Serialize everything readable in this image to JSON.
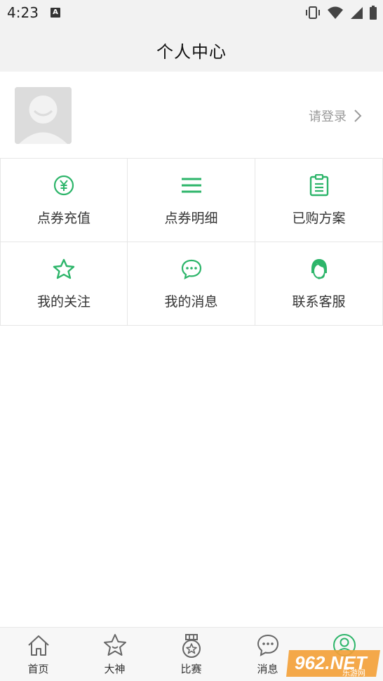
{
  "status_bar": {
    "time": "4:23",
    "notification_icon": "A"
  },
  "header": {
    "title": "个人中心"
  },
  "profile": {
    "login_label": "请登录"
  },
  "grid": [
    {
      "label": "点券充值",
      "icon": "yen-circle-icon"
    },
    {
      "label": "点券明细",
      "icon": "list-lines-icon"
    },
    {
      "label": "已购方案",
      "icon": "clipboard-icon"
    },
    {
      "label": "我的关注",
      "icon": "star-icon"
    },
    {
      "label": "我的消息",
      "icon": "chat-bubble-icon"
    },
    {
      "label": "联系客服",
      "icon": "customer-service-icon"
    }
  ],
  "bottom_nav": [
    {
      "label": "首页",
      "icon": "home-icon"
    },
    {
      "label": "大神",
      "icon": "star-icon"
    },
    {
      "label": "比赛",
      "icon": "medal-icon"
    },
    {
      "label": "消息",
      "icon": "chat-bubble-icon"
    },
    {
      "label": "",
      "icon": "user-icon",
      "active": true
    }
  ],
  "watermark": {
    "text": "962.NET",
    "subtext": "乐游网"
  },
  "colors": {
    "accent": "#2db56a",
    "header_bg": "#f2f2f2",
    "text": "#333333",
    "muted": "#999999"
  }
}
